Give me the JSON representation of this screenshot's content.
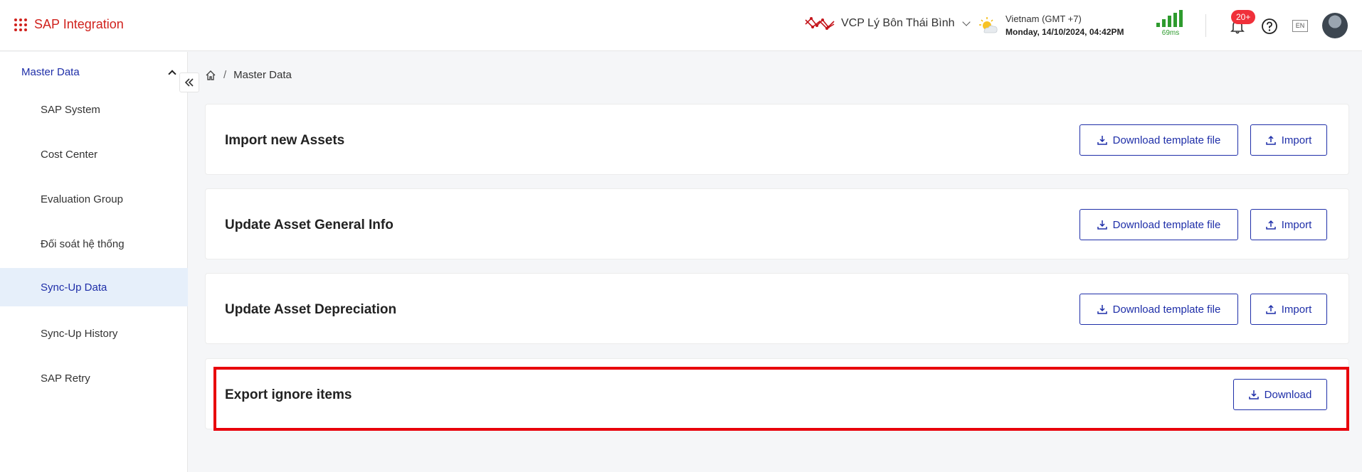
{
  "header": {
    "app_name": "SAP Integration",
    "org_name": "VCP Lý Bôn Thái Bình",
    "timezone": "Vietnam (GMT +7)",
    "datetime": "Monday, 14/10/2024, 04:42PM",
    "latency": "69ms",
    "notification_count": "20+",
    "language": "EN"
  },
  "sidebar": {
    "group_title": "Master Data",
    "items": [
      {
        "label": "SAP System"
      },
      {
        "label": "Cost Center"
      },
      {
        "label": "Evaluation Group"
      },
      {
        "label": "Đối soát hệ thống"
      },
      {
        "label": "Sync-Up Data"
      },
      {
        "label": "Sync-Up History"
      },
      {
        "label": "SAP Retry"
      }
    ]
  },
  "breadcrumb": {
    "separator": "/",
    "current": "Master Data"
  },
  "cards": [
    {
      "title": "Import new Assets",
      "template_label": "Download template file",
      "import_label": "Import"
    },
    {
      "title": "Update Asset General Info",
      "template_label": "Download template file",
      "import_label": "Import"
    },
    {
      "title": "Update Asset Depreciation",
      "template_label": "Download template file",
      "import_label": "Import"
    },
    {
      "title": "Export ignore items",
      "download_label": "Download"
    }
  ],
  "colors": {
    "brand": "#d0211c",
    "accent": "#1e2ea8",
    "active_bg": "#e6effa",
    "highlight": "#e8000b",
    "signal": "#2e9b2e"
  }
}
